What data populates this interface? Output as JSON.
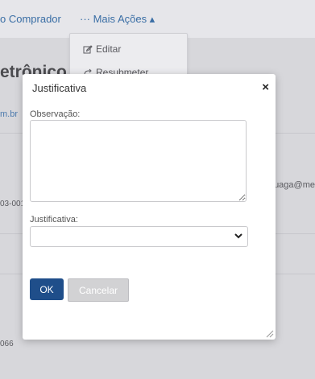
{
  "background": {
    "buyer_link": "o Comprador",
    "more_actions_label": "··· Mais Ações ▴",
    "title_fragment": "etrônico",
    "email_fragment": "m.br",
    "right_email_fragment": "ruaga@me",
    "code_fragment_1": "03-001",
    "code_fragment_2": "066"
  },
  "dropdown": {
    "items": [
      {
        "label": "Editar",
        "icon": "edit-icon"
      },
      {
        "label": "Resubmeter",
        "icon": "resubmit-icon"
      }
    ]
  },
  "modal": {
    "title": "Justificativa",
    "close_label": "×",
    "observation_label": "Observação:",
    "observation_value": "",
    "justification_label": "Justificativa:",
    "justification_selected": "",
    "ok_label": "OK",
    "cancel_label": "Cancelar"
  },
  "colors": {
    "primary_button": "#1f4e8a",
    "link": "#3a6ea5",
    "overlay_bg": "#d3d3d7"
  }
}
